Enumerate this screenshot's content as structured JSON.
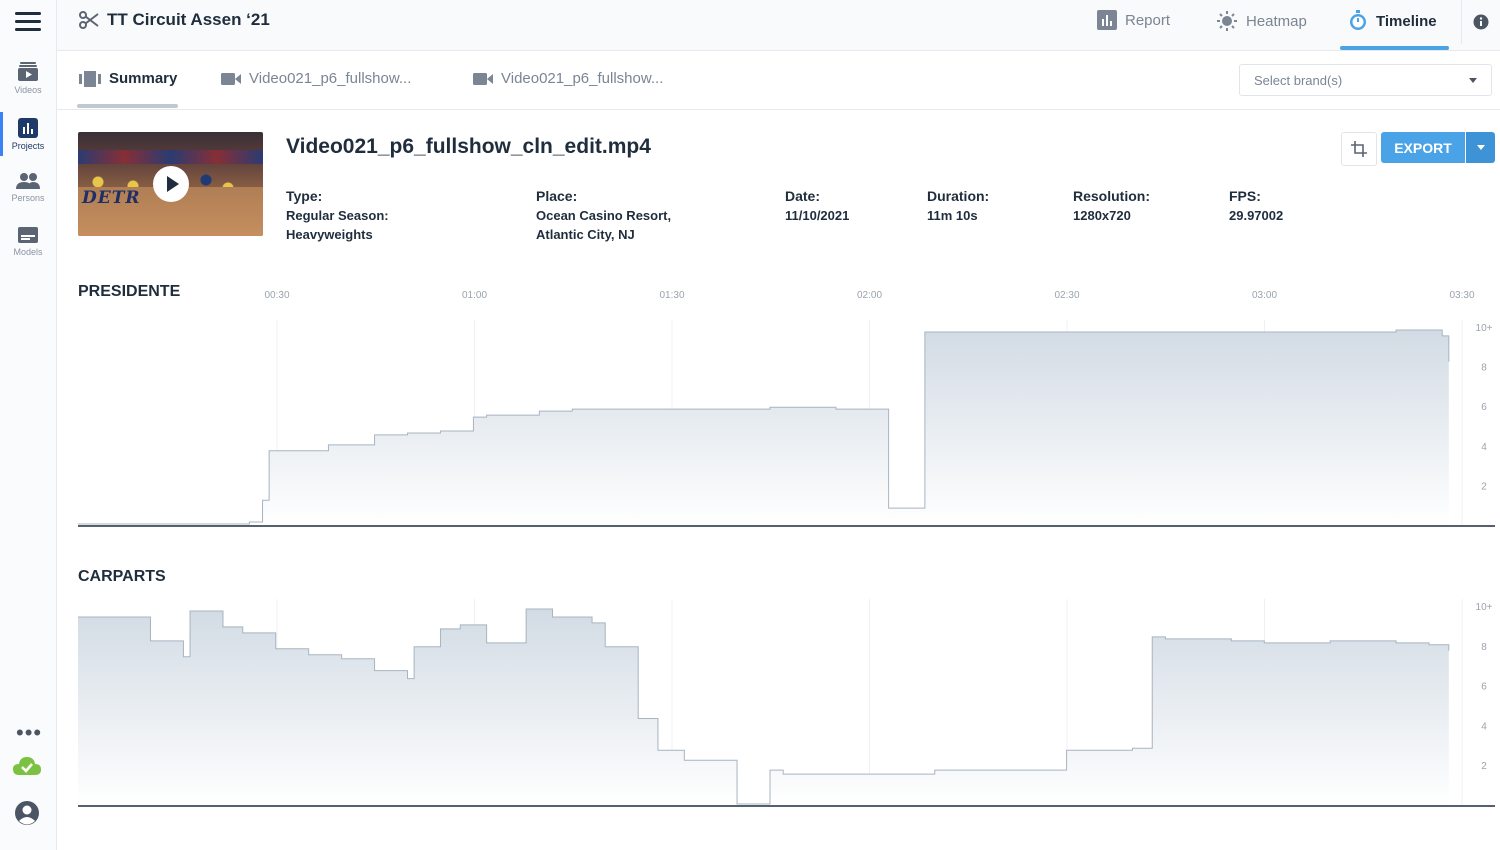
{
  "app": {
    "project_title": "TT Circuit Assen ‘21"
  },
  "sidebar": {
    "items": [
      {
        "label": "Videos",
        "icon": "video-stack-icon"
      },
      {
        "label": "Projects",
        "icon": "bar-chart-icon",
        "active": true
      },
      {
        "label": "Persons",
        "icon": "persons-icon"
      },
      {
        "label": "Models",
        "icon": "models-icon"
      }
    ],
    "more": "•••"
  },
  "header": {
    "tabs": [
      {
        "label": "Report",
        "icon": "report-icon"
      },
      {
        "label": "Heatmap",
        "icon": "heatmap-icon"
      },
      {
        "label": "Timeline",
        "icon": "timeline-icon",
        "active": true
      }
    ]
  },
  "subtabs": {
    "items": [
      {
        "label": "Summary",
        "icon": "film-strip-icon",
        "active": true
      },
      {
        "label": "Video021_p6_fullshow...",
        "icon": "camera-icon"
      },
      {
        "label": "Video021_p6_fullshow...",
        "icon": "camera-icon"
      }
    ],
    "brand_select_placeholder": "Select brand(s)"
  },
  "video": {
    "filename": "Video021_p6_fullshow_cln_edit.mp4",
    "thumb_text": "DETR",
    "meta": {
      "type_label": "Type:",
      "type_value_1": "Regular Season:",
      "type_value_2": "Heavyweights",
      "place_label": "Place:",
      "place_value_1": "Ocean Casino Resort,",
      "place_value_2": "Atlantic City, NJ",
      "date_label": "Date:",
      "date_value": "11/10/2021",
      "duration_label": "Duration:",
      "duration_value": "11m 10s",
      "resolution_label": "Resolution:",
      "resolution_value": "1280x720",
      "fps_label": "FPS:",
      "fps_value": "29.97002"
    },
    "export_label": "EXPORT"
  },
  "chart_data": [
    {
      "type": "area",
      "title": "PRESIDENTE",
      "x_ticks": [
        "00:30",
        "01:00",
        "01:30",
        "02:00",
        "02:30",
        "03:00",
        "03:30"
      ],
      "y_ticks": [
        "2",
        "4",
        "6",
        "8",
        "10+"
      ],
      "ylim": [
        0,
        10
      ],
      "x_unit": "seconds",
      "xlim": [
        0,
        210
      ],
      "grid": true,
      "x": [
        0,
        26,
        28,
        29,
        38,
        45,
        50,
        55,
        60,
        62,
        70,
        75,
        80,
        85,
        90,
        95,
        100,
        105,
        110,
        115,
        120,
        123,
        128,
        128.5,
        132,
        140,
        150,
        160,
        170,
        180,
        190,
        200,
        205,
        207,
        208
      ],
      "values": [
        0.1,
        0.2,
        1.3,
        3.8,
        4.1,
        4.6,
        4.7,
        4.8,
        5.5,
        5.6,
        5.8,
        5.9,
        5.9,
        5.9,
        5.9,
        5.9,
        5.9,
        6.0,
        6.0,
        5.9,
        5.9,
        0.9,
        0.9,
        9.8,
        9.8,
        9.8,
        9.8,
        9.8,
        9.8,
        9.8,
        9.8,
        9.9,
        9.9,
        9.6,
        8.3
      ]
    },
    {
      "type": "area",
      "title": "CARPARTS",
      "x_ticks": [
        "00:30",
        "01:00",
        "01:30",
        "02:00",
        "02:30",
        "03:00",
        "03:30"
      ],
      "y_ticks": [
        "2",
        "4",
        "6",
        "8",
        "10+"
      ],
      "ylim": [
        0,
        10
      ],
      "x_unit": "seconds",
      "xlim": [
        0,
        210
      ],
      "grid": true,
      "x": [
        0,
        6,
        11,
        16,
        17,
        22,
        25,
        30,
        35,
        40,
        45,
        50,
        51,
        55,
        58,
        62,
        68,
        70,
        72,
        78,
        80,
        85,
        88,
        92,
        95,
        100,
        105,
        107,
        110,
        113,
        118,
        120,
        130,
        140,
        150,
        160,
        163,
        165,
        170,
        175,
        180,
        190,
        200,
        205,
        208
      ],
      "values": [
        9.5,
        9.5,
        8.3,
        7.5,
        9.8,
        9.0,
        8.7,
        7.9,
        7.6,
        7.4,
        6.8,
        6.4,
        8.0,
        8.9,
        9.1,
        8.2,
        9.9,
        9.9,
        9.5,
        9.2,
        8.0,
        4.4,
        2.8,
        2.3,
        2.3,
        0.1,
        1.8,
        1.6,
        1.6,
        1.6,
        1.6,
        1.6,
        1.8,
        1.8,
        2.8,
        2.9,
        8.5,
        8.4,
        8.4,
        8.3,
        8.2,
        8.3,
        8.2,
        8.1,
        7.8
      ]
    }
  ],
  "colors": {
    "accent": "#4aa3e6",
    "area_fill_top": "#d2dbe4",
    "area_line": "#a7b4c2",
    "baseline": "#1f2d3d"
  }
}
